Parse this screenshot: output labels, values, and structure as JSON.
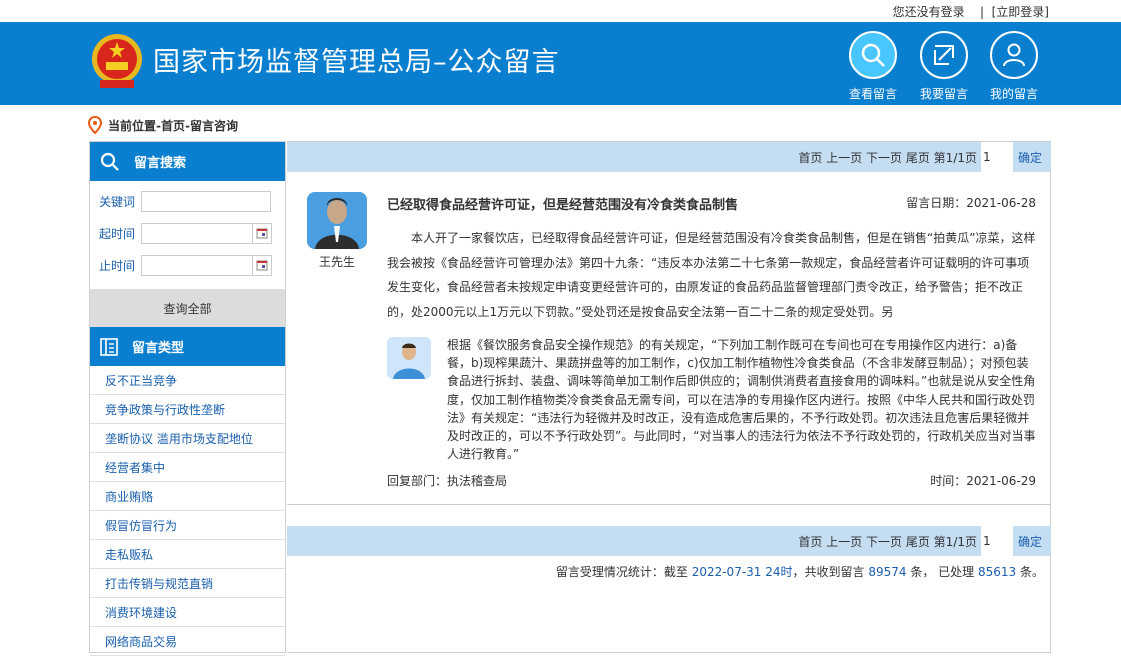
{
  "topbar": {
    "login_status": "您还没有登录",
    "separator": "|",
    "login_link": "[立即登录]"
  },
  "header": {
    "site_title": "国家市场监督管理总局–公众留言",
    "buttons": [
      {
        "label": "查看留言",
        "icon": "search-icon"
      },
      {
        "label": "我要留言",
        "icon": "edit-icon"
      },
      {
        "label": "我的留言",
        "icon": "user-icon"
      }
    ]
  },
  "breadcrumb": {
    "text": "当前位置-首页-留言咨询"
  },
  "sidebar": {
    "search_title": "留言搜索",
    "keyword_label": "关键词",
    "start_label": "起时间",
    "end_label": "止时间",
    "query_all": "查询全部",
    "type_title": "留言类型",
    "categories": [
      "反不正当竞争",
      "竞争政策与行政性垄断",
      "垄断协议 滥用市场支配地位",
      "经营者集中",
      "商业贿赂",
      "假冒仿冒行为",
      "走私贩私",
      "打击传销与规范直销",
      "消费环境建设",
      "网络商品交易"
    ]
  },
  "pager": {
    "text": "首页 上一页 下一页 尾页  第1/1页",
    "page_value": "1",
    "confirm": "确定"
  },
  "message": {
    "user": "王先生",
    "title": "已经取得食品经营许可证，但是经营范围没有冷食类食品制售",
    "date": "留言日期：2021-06-28",
    "body": "本人开了一家餐饮店，已经取得食品经营许可证，但是经营范围没有冷食类食品制售，但是在销售“拍黄瓜”凉菜，这样我会被按《食品经营许可管理办法》第四十九条：“违反本办法第二十七条第一款规定，食品经营者许可证载明的许可事项发生变化，食品经营者未按规定申请变更经营许可的，由原发证的食品药品监督管理部门责令改正，给予警告；拒不改正的，处2000元以上1万元以下罚款。”受处罚还是按食品安全法第一百二十二条的规定受处罚。另",
    "reply": "根据《餐饮服务食品安全操作规范》的有关规定，“下列加工制作既可在专间也可在专用操作区内进行：a)备餐，b)现榨果蔬汁、果蔬拼盘等的加工制作，c)仅加工制作植物性冷食类食品（不含非发酵豆制品）；对预包装食品进行拆封、装盘、调味等简单加工制作后即供应的；调制供消费者直接食用的调味料。”也就是说从安全性角度，仅加工制作植物类冷食类食品无需专间，可以在洁净的专用操作区内进行。按照《中华人民共和国行政处罚法》有关规定：“违法行为轻微并及时改正，没有造成危害后果的，不予行政处罚。初次违法且危害后果轻微并及时改正的，可以不予行政处罚”。与此同时，“对当事人的违法行为依法不予行政处罚的，行政机关应当对当事人进行教育。”",
    "reply_dept": "回复部门：执法稽查局",
    "reply_time": "时间：2021-06-29"
  },
  "stats": {
    "prefix": "留言受理情况统计：截至 ",
    "date": "2022-07-31 24时",
    "mid1": "，共收到留言 ",
    "received": "89574",
    "mid2": " 条， 已处理 ",
    "processed": "85613",
    "suffix": " 条。"
  },
  "colors": {
    "brand_blue": "#0a7fd0",
    "pager_bg": "#c5ddf3",
    "link_blue": "#1a5fae"
  }
}
